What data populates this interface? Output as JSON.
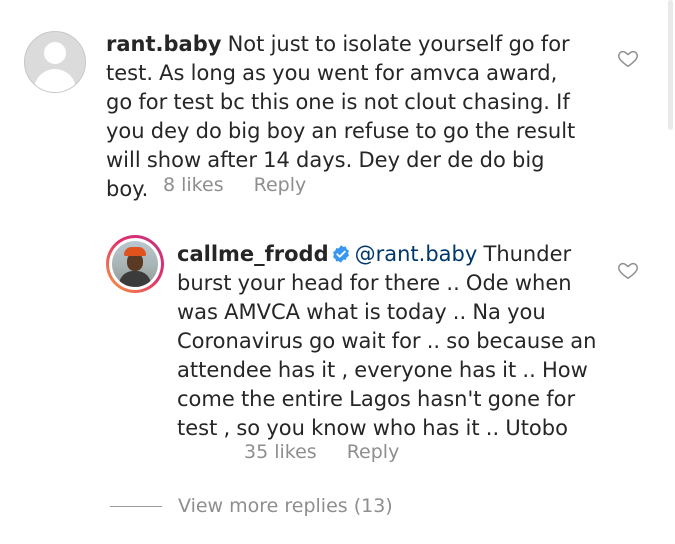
{
  "comments": [
    {
      "username": "rant.baby",
      "text": " Not just to isolate yourself go for test. As long as you went for amvca award, go for test bc this one is not clout chasing. If you dey do big boy an refuse to go the result will show after 14 days. Dey der de do big boy.",
      "likes": "8 likes",
      "reply_label": "Reply"
    }
  ],
  "reply": {
    "username": "callme_frodd",
    "verified": true,
    "mention": "@rant.baby",
    "text": " Thunder burst your head for there .. Ode when was AMVCA what is today .. Na you Coronavirus go wait for .. so because an attendee has it , everyone has it .. How come the entire Lagos hasn't gone for test , so you know who has it .. Utobo",
    "likes": "35 likes",
    "reply_label": "Reply"
  },
  "view_more": "View more replies (13)",
  "icons": {
    "like": "heart-outline-icon",
    "verified": "verified-badge-icon",
    "default_avatar": "default-avatar-icon"
  },
  "colors": {
    "text": "#262626",
    "meta": "#8e8e8e",
    "mention": "#00376b",
    "verified": "#3897f0"
  }
}
